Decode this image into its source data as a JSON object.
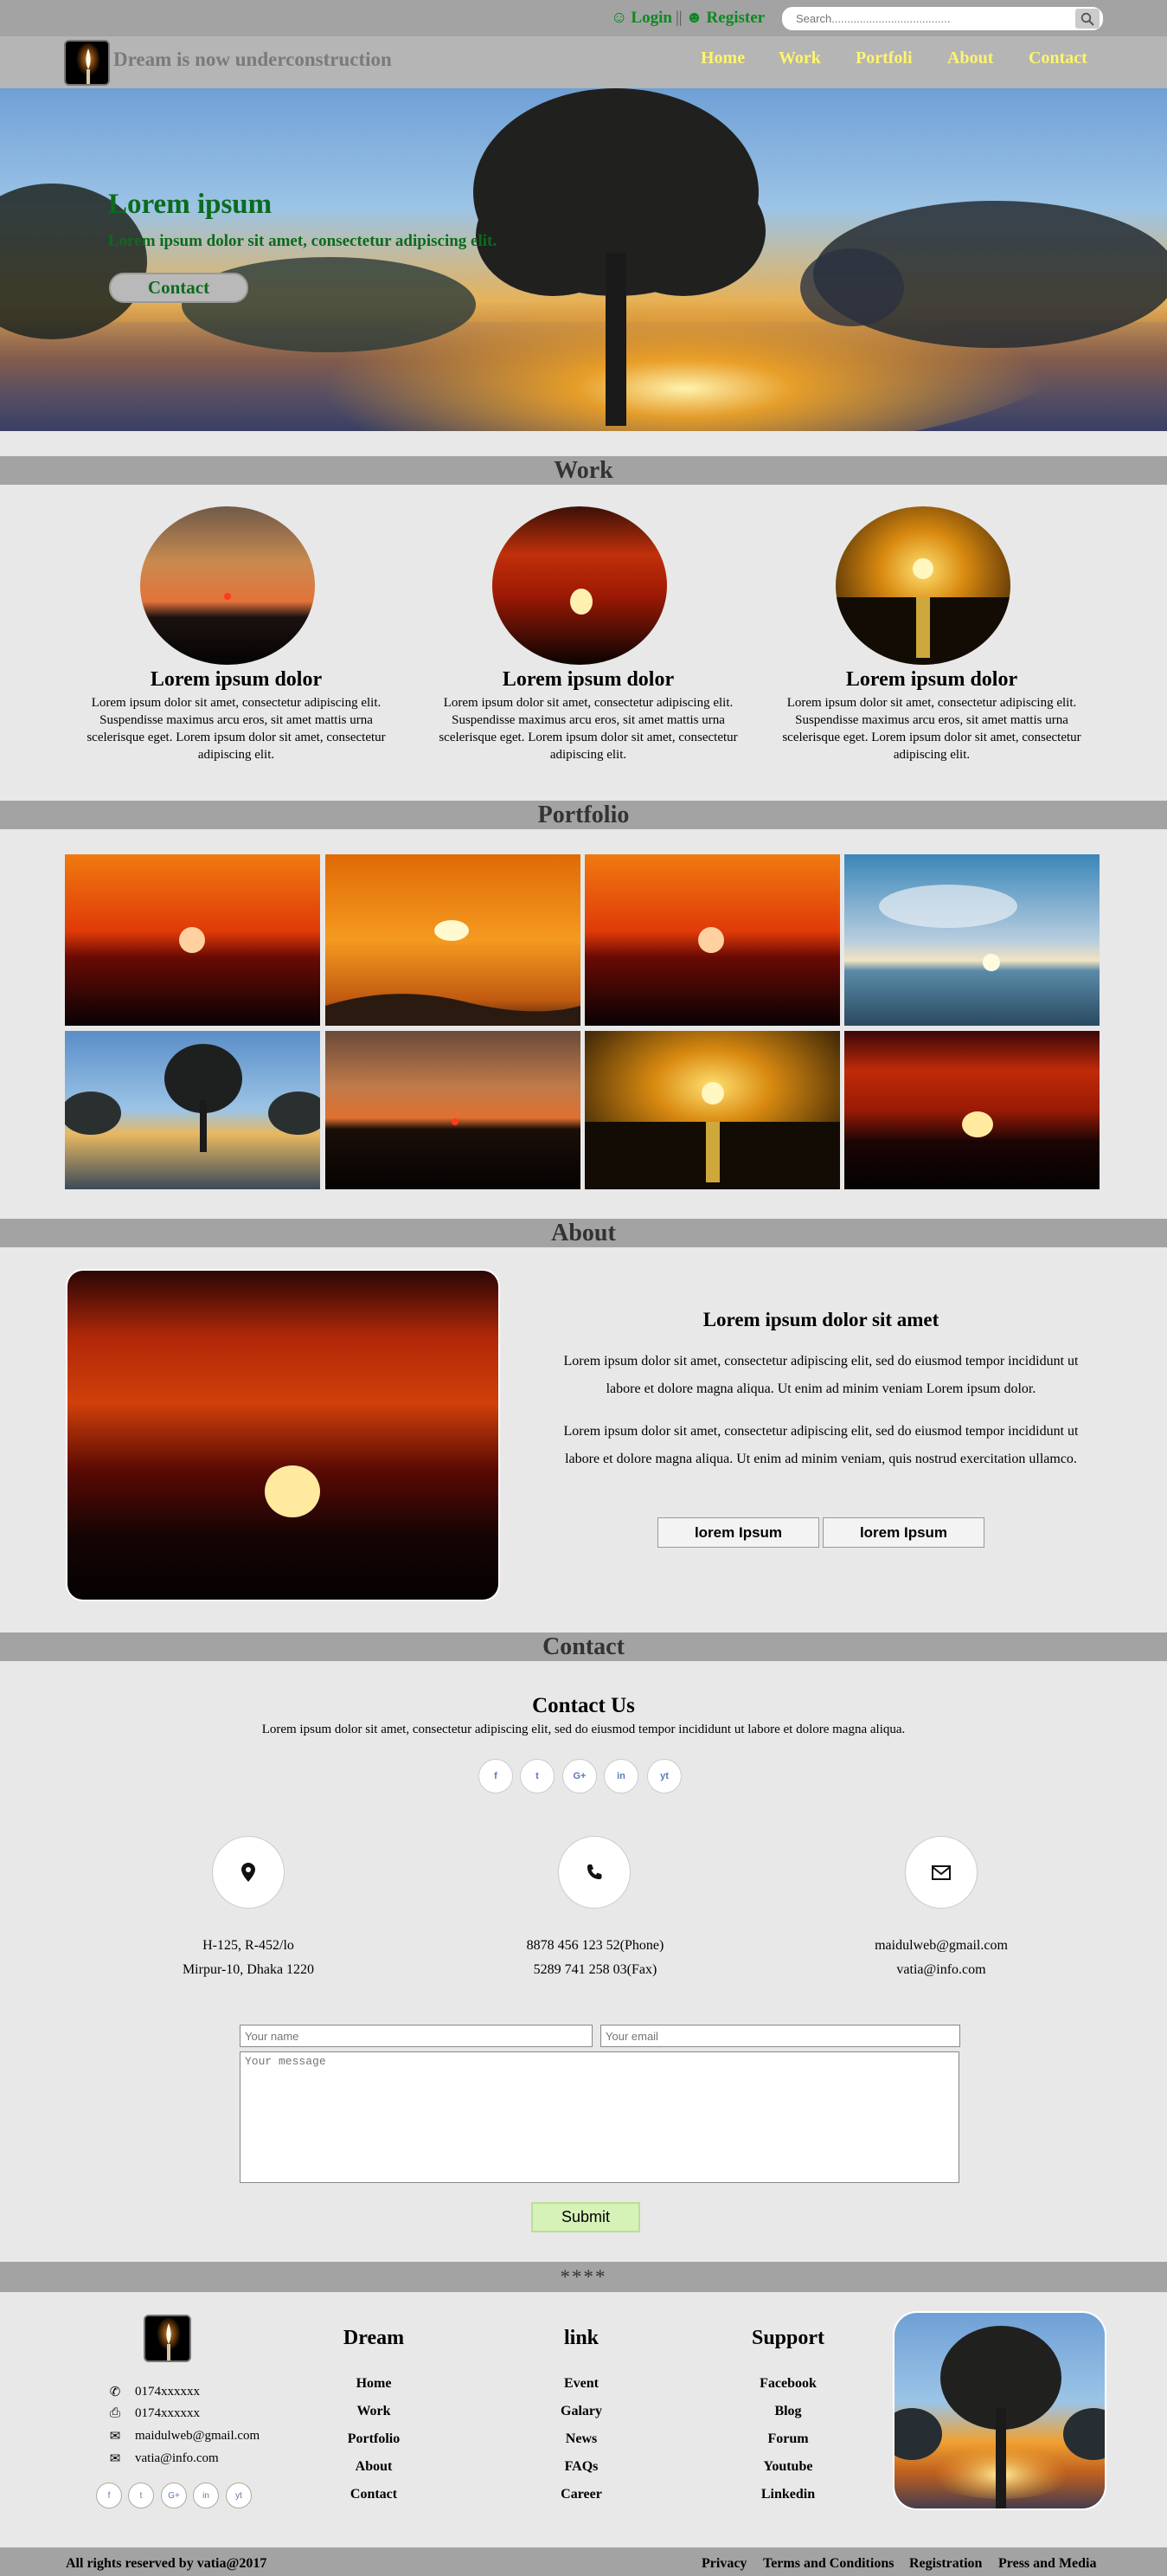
{
  "header": {
    "login_label": "Login",
    "separator": "||",
    "register_label": "Register",
    "search_placeholder": "Search......................................"
  },
  "nav": {
    "site_title": "Dream is now underconstruction",
    "links": [
      "Home",
      "Work",
      "Portfoli",
      "About",
      "Contact"
    ]
  },
  "hero": {
    "title": "Lorem ipsum",
    "subtitle": "Lorem ipsum dolor sit amet, consectetur adipiscing elit.",
    "button_label": "Contact"
  },
  "work": {
    "heading": "Work",
    "items": [
      {
        "title": "Lorem ipsum dolor",
        "text": "Lorem ipsum dolor sit amet, consectetur adipiscing elit. Suspendisse maximus arcu eros, sit amet mattis urna scelerisque eget. Lorem ipsum dolor sit amet, consectetur adipiscing elit."
      },
      {
        "title": "Lorem ipsum dolor",
        "text": "Lorem ipsum dolor sit amet, consectetur adipiscing elit. Suspendisse maximus arcu eros, sit amet mattis urna scelerisque eget. Lorem ipsum dolor sit amet, consectetur adipiscing elit."
      },
      {
        "title": "Lorem ipsum dolor",
        "text": "Lorem ipsum dolor sit amet, consectetur adipiscing elit. Suspendisse maximus arcu eros, sit amet mattis urna scelerisque eget. Lorem ipsum dolor sit amet, consectetur adipiscing elit."
      }
    ]
  },
  "portfolio": {
    "heading": "Portfolio"
  },
  "about": {
    "heading": "About",
    "title": "Lorem ipsum dolor sit amet",
    "paragraph1": "Lorem ipsum dolor sit amet, consectetur adipiscing elit, sed do eiusmod tempor incididunt ut labore et dolore magna aliqua. Ut enim ad minim veniam Lorem ipsum dolor.",
    "paragraph2": "Lorem ipsum dolor sit amet, consectetur adipiscing elit, sed do eiusmod tempor incididunt ut labore et dolore magna aliqua. Ut enim ad minim veniam, quis nostrud exercitation ullamco.",
    "button1": "lorem Ipsum",
    "button2": "lorem Ipsum"
  },
  "contact": {
    "heading": "Contact",
    "title": "Contact Us",
    "subtitle": "Lorem ipsum dolor sit amet, consectetur adipiscing elit, sed do eiusmod tempor incididunt ut labore et dolore magna aliqua.",
    "social": [
      "f",
      "t",
      "G+",
      "in",
      "yt"
    ],
    "address": [
      "H-125, R-452/lo",
      "Mirpur-10, Dhaka 1220"
    ],
    "phone": [
      "8878 456 123 52(Phone)",
      "5289 741 258 03(Fax)"
    ],
    "email": [
      "maidulweb@gmail.com",
      "vatia@info.com"
    ],
    "name_placeholder": "Your name",
    "email_placeholder": "Your email",
    "message_placeholder": "Your message",
    "submit_label": "Submit"
  },
  "footer": {
    "stars": "****",
    "contact_lines": [
      "0174xxxxxx",
      "0174xxxxxx",
      "maidulweb@gmail.com",
      "vatia@info.com"
    ],
    "columns": [
      {
        "title": "Dream",
        "links": [
          "Home",
          "Work",
          "Portfolio",
          "About",
          "Contact"
        ]
      },
      {
        "title": "link",
        "links": [
          "Event",
          "Galary",
          "News",
          "FAQs",
          "Career"
        ]
      },
      {
        "title": "Support",
        "links": [
          "Facebook",
          "Blog",
          "Forum",
          "Youtube",
          "Linkedin"
        ]
      }
    ],
    "copyright": "All rights reserved by vatia@2017",
    "bottom_links": [
      "Privacy",
      "Terms and Conditions",
      "Registration",
      "Press and Media"
    ]
  },
  "colors": {
    "accent_green": "#0b8a1f",
    "nav_link_yellow": "#fff56b",
    "bar_gray": "#a3a3a3",
    "page_bg": "#e8e8e8"
  }
}
